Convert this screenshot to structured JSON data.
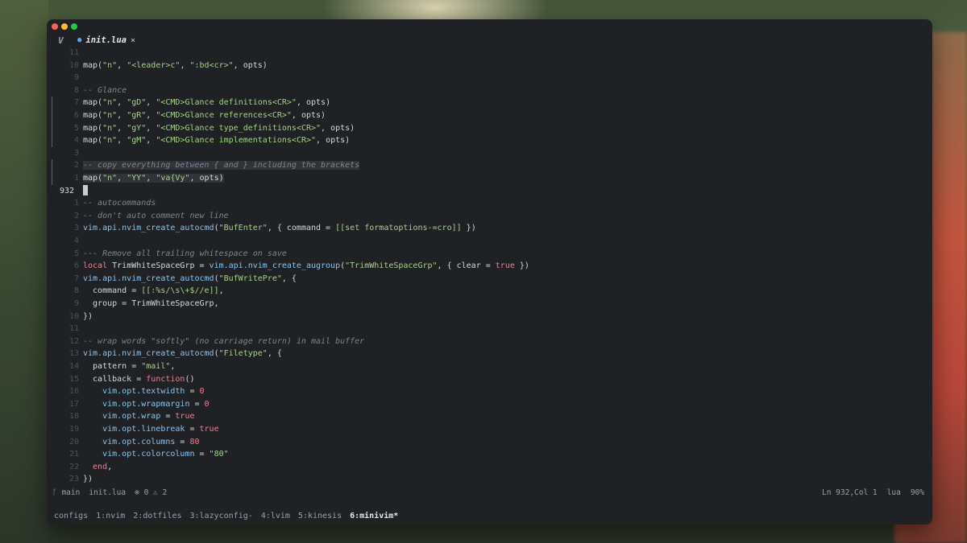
{
  "tab": {
    "filename": "init.lua",
    "close_glyph": "×",
    "vim_glyph": "V",
    "lua_glyph": "●"
  },
  "editor": {
    "lines": [
      {
        "n": "11",
        "tokens": []
      },
      {
        "n": "10",
        "tokens": [
          [
            "t",
            "map("
          ],
          [
            "s",
            "\"n\""
          ],
          [
            "t",
            ", "
          ],
          [
            "s",
            "\"<leader>c\""
          ],
          [
            "t",
            ", "
          ],
          [
            "s",
            "\":bd<cr>\""
          ],
          [
            "t",
            ", opts)"
          ]
        ]
      },
      {
        "n": "9",
        "tokens": []
      },
      {
        "n": "8",
        "tokens": [
          [
            "c",
            "-- Glance"
          ]
        ]
      },
      {
        "n": "7",
        "mark": true,
        "tokens": [
          [
            "t",
            "map("
          ],
          [
            "s",
            "\"n\""
          ],
          [
            "t",
            ", "
          ],
          [
            "s",
            "\"gD\""
          ],
          [
            "t",
            ", "
          ],
          [
            "s",
            "\"<CMD>Glance definitions<CR>\""
          ],
          [
            "t",
            ", opts)"
          ]
        ]
      },
      {
        "n": "6",
        "mark": true,
        "tokens": [
          [
            "t",
            "map("
          ],
          [
            "s",
            "\"n\""
          ],
          [
            "t",
            ", "
          ],
          [
            "s",
            "\"gR\""
          ],
          [
            "t",
            ", "
          ],
          [
            "s",
            "\"<CMD>Glance references<CR>\""
          ],
          [
            "t",
            ", opts)"
          ]
        ]
      },
      {
        "n": "5",
        "mark": true,
        "tokens": [
          [
            "t",
            "map("
          ],
          [
            "s",
            "\"n\""
          ],
          [
            "t",
            ", "
          ],
          [
            "s",
            "\"gY\""
          ],
          [
            "t",
            ", "
          ],
          [
            "s",
            "\"<CMD>Glance type_definitions<CR>\""
          ],
          [
            "t",
            ", opts)"
          ]
        ]
      },
      {
        "n": "4",
        "mark": true,
        "tokens": [
          [
            "t",
            "map("
          ],
          [
            "s",
            "\"n\""
          ],
          [
            "t",
            ", "
          ],
          [
            "s",
            "\"gM\""
          ],
          [
            "t",
            ", "
          ],
          [
            "s",
            "\"<CMD>Glance implementations<CR>\""
          ],
          [
            "t",
            ", opts)"
          ]
        ]
      },
      {
        "n": "3",
        "tokens": []
      },
      {
        "n": "2",
        "mark": true,
        "hl": true,
        "tokens": [
          [
            "c",
            "-- copy everything between { and } including the brackets"
          ]
        ]
      },
      {
        "n": "1",
        "mark": true,
        "hl": true,
        "tokens": [
          [
            "t",
            "map("
          ],
          [
            "s",
            "\"n\""
          ],
          [
            "t",
            ", "
          ],
          [
            "s",
            "\"YY\""
          ],
          [
            "t",
            ", "
          ],
          [
            "s",
            "\"va{Vy\""
          ],
          [
            "t",
            ", opts)"
          ]
        ]
      },
      {
        "n": "932",
        "current": true,
        "tokens": []
      },
      {
        "n": "1",
        "tokens": [
          [
            "c",
            "-- autocommands"
          ]
        ]
      },
      {
        "n": "2",
        "tokens": [
          [
            "c",
            "-- don't auto comment new line"
          ]
        ]
      },
      {
        "n": "3",
        "tokens": [
          [
            "f",
            "vim.api.nvim_create_autocmd"
          ],
          [
            "t",
            "("
          ],
          [
            "s",
            "\"BufEnter\""
          ],
          [
            "t",
            ", { command = "
          ],
          [
            "s",
            "[[set formatoptions-=cro]]"
          ],
          [
            "t",
            " })"
          ]
        ]
      },
      {
        "n": "4",
        "tokens": []
      },
      {
        "n": "5",
        "tokens": [
          [
            "c",
            "--- Remove all trailing whitespace on save"
          ]
        ]
      },
      {
        "n": "6",
        "tokens": [
          [
            "k",
            "local"
          ],
          [
            "t",
            " TrimWhiteSpaceGrp = "
          ],
          [
            "f",
            "vim.api.nvim_create_augroup"
          ],
          [
            "t",
            "("
          ],
          [
            "s",
            "\"TrimWhiteSpaceGrp\""
          ],
          [
            "t",
            ", { clear = "
          ],
          [
            "k",
            "true"
          ],
          [
            "t",
            " })"
          ]
        ]
      },
      {
        "n": "7",
        "tokens": [
          [
            "f",
            "vim.api.nvim_create_autocmd"
          ],
          [
            "t",
            "("
          ],
          [
            "s",
            "\"BufWritePre\""
          ],
          [
            "t",
            ", {"
          ]
        ]
      },
      {
        "n": "8",
        "tokens": [
          [
            "t",
            "  command = "
          ],
          [
            "s",
            "[[:%s/\\s\\+$//e]]"
          ],
          [
            "t",
            ","
          ]
        ]
      },
      {
        "n": "9",
        "tokens": [
          [
            "t",
            "  group = TrimWhiteSpaceGrp,"
          ]
        ]
      },
      {
        "n": "10",
        "tokens": [
          [
            "t",
            "})"
          ]
        ]
      },
      {
        "n": "11",
        "tokens": []
      },
      {
        "n": "12",
        "tokens": [
          [
            "c",
            "-- wrap words \"softly\" (no carriage return) in mail buffer"
          ]
        ]
      },
      {
        "n": "13",
        "tokens": [
          [
            "f",
            "vim.api.nvim_create_autocmd"
          ],
          [
            "t",
            "("
          ],
          [
            "s",
            "\"Filetype\""
          ],
          [
            "t",
            ", {"
          ]
        ]
      },
      {
        "n": "14",
        "tokens": [
          [
            "t",
            "  pattern = "
          ],
          [
            "s",
            "\"mail\""
          ],
          [
            "t",
            ","
          ]
        ]
      },
      {
        "n": "15",
        "tokens": [
          [
            "t",
            "  callback = "
          ],
          [
            "k",
            "function"
          ],
          [
            "t",
            "()"
          ]
        ]
      },
      {
        "n": "16",
        "tokens": [
          [
            "t",
            "    "
          ],
          [
            "f",
            "vim.opt.textwidth"
          ],
          [
            "t",
            " = "
          ],
          [
            "k",
            "0"
          ]
        ]
      },
      {
        "n": "17",
        "tokens": [
          [
            "t",
            "    "
          ],
          [
            "f",
            "vim.opt.wrapmargin"
          ],
          [
            "t",
            " = "
          ],
          [
            "k",
            "0"
          ]
        ]
      },
      {
        "n": "18",
        "tokens": [
          [
            "t",
            "    "
          ],
          [
            "f",
            "vim.opt.wrap"
          ],
          [
            "t",
            " = "
          ],
          [
            "k",
            "true"
          ]
        ]
      },
      {
        "n": "19",
        "tokens": [
          [
            "t",
            "    "
          ],
          [
            "f",
            "vim.opt.linebreak"
          ],
          [
            "t",
            " = "
          ],
          [
            "k",
            "true"
          ]
        ]
      },
      {
        "n": "20",
        "tokens": [
          [
            "t",
            "    "
          ],
          [
            "f",
            "vim.opt.columns"
          ],
          [
            "t",
            " = "
          ],
          [
            "k",
            "80"
          ]
        ]
      },
      {
        "n": "21",
        "tokens": [
          [
            "t",
            "    "
          ],
          [
            "f",
            "vim.opt.colorcolumn"
          ],
          [
            "t",
            " = "
          ],
          [
            "s",
            "\"80\""
          ]
        ]
      },
      {
        "n": "22",
        "tokens": [
          [
            "k",
            "  end"
          ],
          [
            "t",
            ","
          ]
        ]
      },
      {
        "n": "23",
        "tokens": [
          [
            "t",
            "})"
          ]
        ]
      }
    ]
  },
  "status": {
    "branch": "main",
    "branch_glyph": "ᚴ",
    "file": "init.lua",
    "errors": "0",
    "error_glyph": "⊗",
    "warnings": "2",
    "warning_glyph": "⚠",
    "position": "Ln 932,Col 1",
    "filetype": "lua",
    "percent": "90%"
  },
  "tmux": {
    "session": "configs",
    "windows": [
      "1:nvim",
      "2:dotfiles",
      "3:lazyconfig-",
      "4:lvim",
      "5:kinesis",
      "6:minivim*"
    ],
    "active_index": 5
  }
}
